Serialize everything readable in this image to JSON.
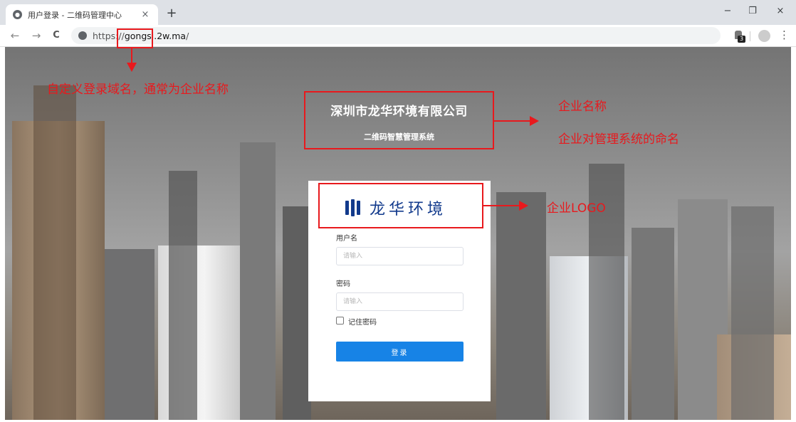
{
  "browser": {
    "tab_title": "用户登录 - 二维码管理中心",
    "tab_close": "×",
    "new_tab": "+",
    "back": "←",
    "forward": "→",
    "reload": "C",
    "url_scheme": "https://",
    "url_host": "gongsi.2w.ma",
    "url_path": "/",
    "extension_badge": "3",
    "minimize": "−",
    "restore": "❐",
    "close": "×",
    "menu": "⋮"
  },
  "page": {
    "company_name": "深圳市龙华环境有限公司",
    "system_name": "二维码智慧管理系统",
    "logo_text": "龙华环境",
    "login": {
      "username_label": "用户名",
      "username_placeholder": "请输入",
      "password_label": "密码",
      "password_placeholder": "请输入",
      "remember_label": "记住密码",
      "submit_label": "登录"
    }
  },
  "annotations": {
    "domain_note": "自定义登录域名，通常为企业名称",
    "company_note": "企业名称",
    "system_note": "企业对管理系统的命名",
    "logo_note": "企业LOGO"
  },
  "colors": {
    "annotation": "#e8191d",
    "primary_button": "#1783e6",
    "logo": "#123a8c"
  }
}
